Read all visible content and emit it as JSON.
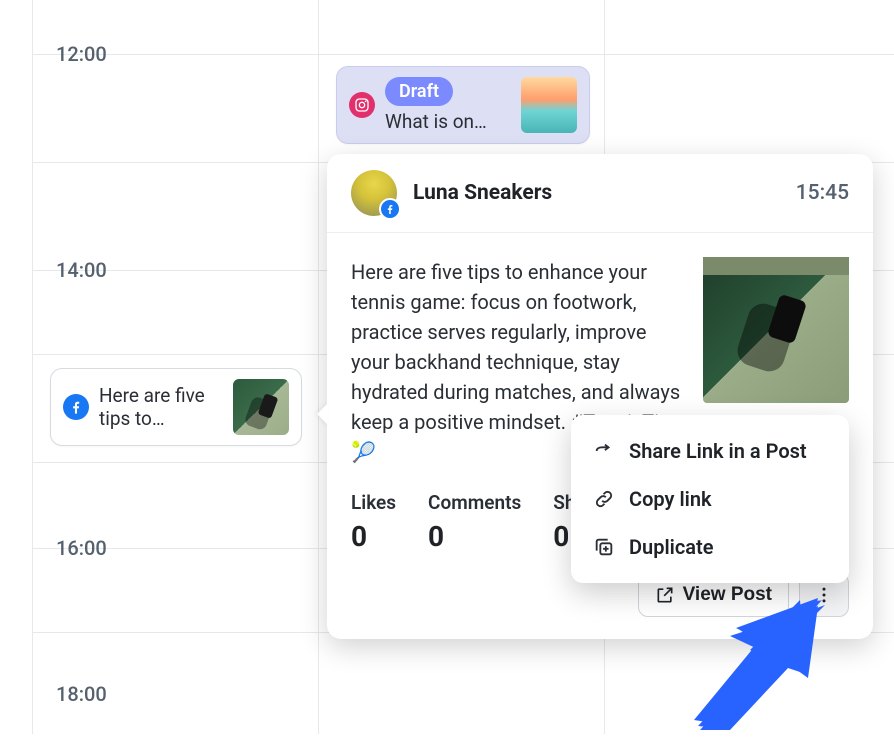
{
  "time_labels": [
    "12:00",
    "14:00",
    "16:00",
    "18:00"
  ],
  "events": {
    "draft": {
      "badge_label": "Draft",
      "snippet": "What is on…"
    },
    "tennis_small": {
      "snippet": "Here are five tips to…"
    }
  },
  "popover": {
    "account_name": "Luna Sneakers",
    "time": "15:45",
    "body": "Here are five tips to enhance your tennis game: focus on footwork, practice serves regularly, improve your backhand technique, stay hydrated during matches, and always keep a positive mindset. #TennisTips 🎾",
    "stats": {
      "likes_label": "Likes",
      "likes_value": "0",
      "comments_label": "Comments",
      "comments_value": "0",
      "shares_label": "Share",
      "shares_value": "0"
    },
    "view_post_label": "View Post"
  },
  "context_menu": {
    "share": "Share Link in a Post",
    "copy": "Copy link",
    "duplicate": "Duplicate"
  }
}
